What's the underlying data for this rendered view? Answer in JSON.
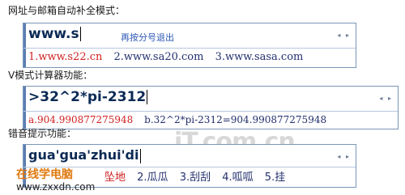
{
  "sections": [
    {
      "heading": "网址与邮箱自动补全模式：",
      "input": "www.s",
      "hint": "再按分号退出",
      "arrows": "◂ ▸",
      "candidates": [
        "1.www.s22.cn",
        "2.www.sa20.com",
        "3.www.sasa.com"
      ]
    },
    {
      "heading": "V模式计算器功能：",
      "input": ">32^2*pi-2312",
      "hint": "",
      "arrows": "◂ ▸",
      "candidates": [
        "a.904.990877275948",
        "b.32^2*pi-2312=904.990877275948"
      ]
    },
    {
      "heading": "错音提示功能：",
      "input": "gua'gua'zhui'di",
      "hint": "",
      "arrows": "◂ ▸",
      "candidates": [
        "坠地",
        "2.瓜瓜",
        "3.刮刮",
        "4.呱呱",
        "5.挂"
      ]
    }
  ],
  "watermark": "iT.com.cn",
  "brand": "在线学电脑",
  "site": "www.zxxdn.com"
}
